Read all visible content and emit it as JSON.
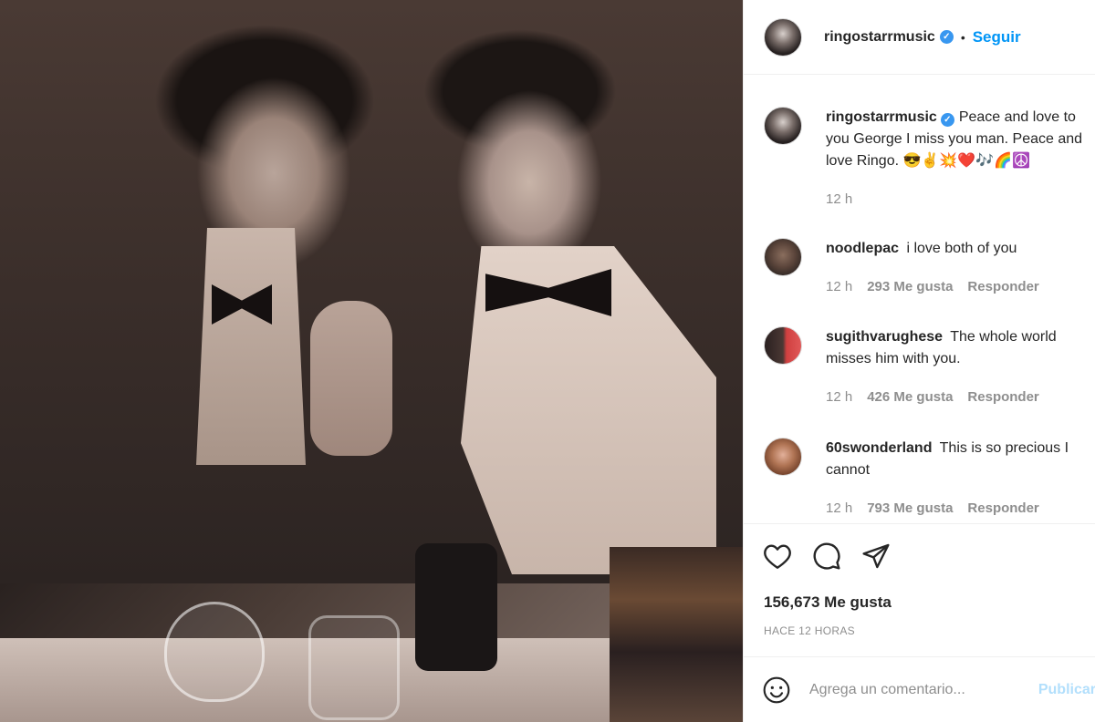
{
  "post": {
    "image_alt": "Black and white photo"
  },
  "header": {
    "username": "ringostarrmusic",
    "separator": "•",
    "follow_label": "Seguir"
  },
  "caption": {
    "username": "ringostarrmusic",
    "text": "Peace and love to",
    "line2": "you George I miss you man. Peace and",
    "line3": "love Ringo. 😎✌️💥❤️🎶🌈☮️",
    "time": "12 h"
  },
  "comments": [
    {
      "username": "noodlepac",
      "text": "i love both of you",
      "text2": "",
      "time": "12 h",
      "likes": "293 Me gusta",
      "reply": "Responder"
    },
    {
      "username": "sugithvarughese",
      "text": "The whole world",
      "text2": "misses him with you.",
      "time": "12 h",
      "likes": "426 Me gusta",
      "reply": "Responder"
    },
    {
      "username": "60swonderland",
      "text": "This is so precious I",
      "text2": "cannot",
      "time": "12 h",
      "likes": "793 Me gusta",
      "reply": "Responder"
    }
  ],
  "footer": {
    "likes_count": "156,673 Me gusta",
    "timestamp": "HACE 12 HORAS",
    "comment_placeholder": "Agrega un comentario...",
    "post_label": "Publicar"
  },
  "colors": {
    "follow": "#0095f6",
    "verified": "#3897f0",
    "muted": "#8e8e8e"
  }
}
